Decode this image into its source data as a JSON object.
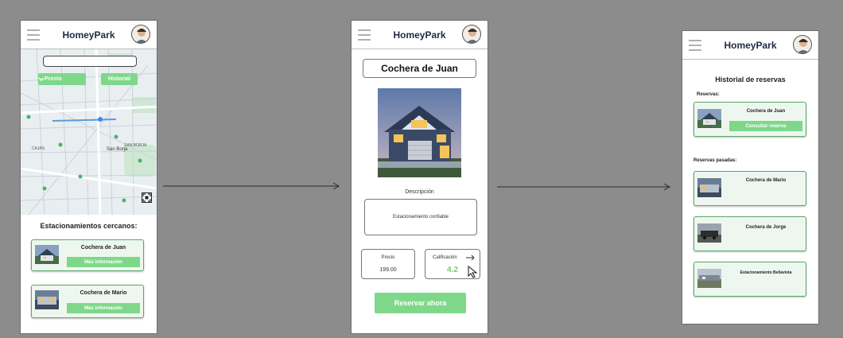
{
  "app": {
    "name": "HomeyPark"
  },
  "screen1": {
    "filter_price": "Precio",
    "filter_history": "Historial",
    "nearby_title": "Estacionamientos cercanos:",
    "map_labels": [
      "SAN BORJA",
      "San Borja",
      "CAJAS"
    ],
    "cards": [
      {
        "name": "Cochera de Juan",
        "button": "Más información"
      },
      {
        "name": "Cochera de Mario",
        "button": "Más información"
      }
    ]
  },
  "screen2": {
    "title": "Cochera de Juan",
    "description_label": "Descripción",
    "description_text": "Estacionamiento confiable",
    "price_label": "Precio",
    "price_value": "199.00",
    "rating_label": "Calificación",
    "rating_value": "4.2",
    "reserve_button": "Reservar ahora"
  },
  "screen3": {
    "title": "Historial de reservas",
    "current_label": "Reservas:",
    "current": {
      "name": "Cochera de Juan",
      "button": "Consultar reserva"
    },
    "past_label": "Reservas pasadas:",
    "past": [
      {
        "name": "Cochera de Mario"
      },
      {
        "name": "Cochera de Jorge"
      },
      {
        "name": "Estacionamiento Bellavista"
      }
    ]
  },
  "colors": {
    "accent": "#7fd88a",
    "brand_text": "#1f2a44",
    "background": "#8c8c8c",
    "rating": "#6fd06e"
  }
}
